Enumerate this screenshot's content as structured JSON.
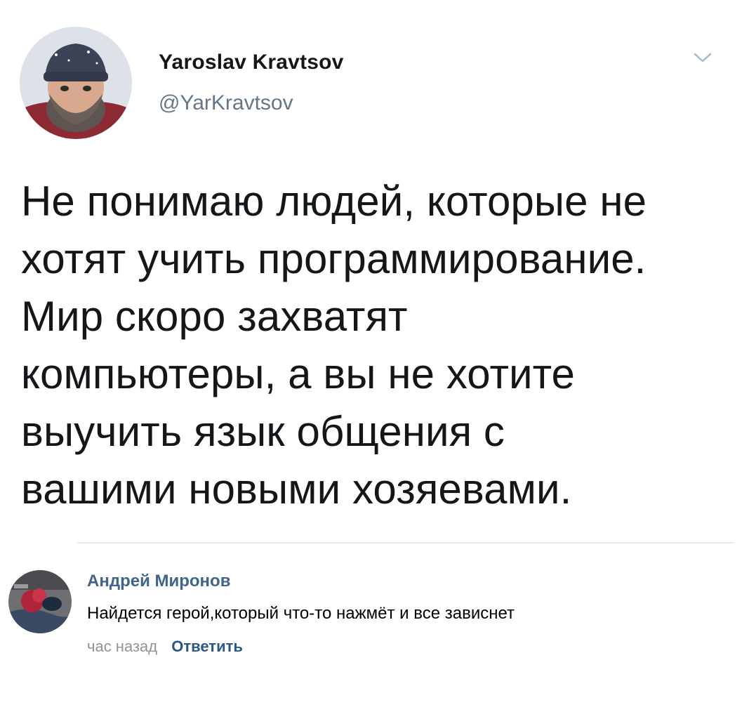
{
  "tweet": {
    "display_name": "Yaroslav Kravtsov",
    "handle": "@YarKravtsov",
    "text": "Не понимаю людей, которые не\nхотят учить программирование.\nМир скоро захватят\nкомпьютеры, а вы не хотите\nвыучить язык общения с\nвашими новыми хозяевами.",
    "menu_icon": "chevron-down-icon"
  },
  "comment": {
    "author": "Андрей Миронов",
    "text": "Найдется герой,который что-то нажмёт и все зависнет",
    "time": "час назад",
    "reply_label": "Ответить"
  },
  "colors": {
    "handle_gray": "#657786",
    "comment_link_blue": "#42648b",
    "reply_blue": "#2a5885",
    "time_gray": "#939393"
  }
}
